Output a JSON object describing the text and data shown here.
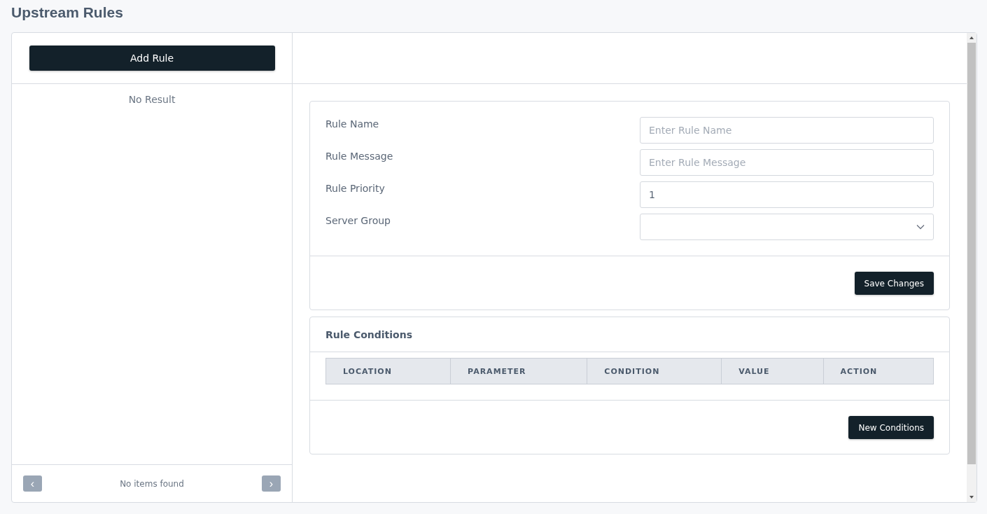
{
  "page_title": "Upstream Rules",
  "sidebar": {
    "add_button": "Add Rule",
    "empty_text": "No Result",
    "pager": {
      "prev": "‹",
      "next": "›",
      "status": "No items found"
    }
  },
  "rule_form": {
    "fields": [
      {
        "label": "Rule Name",
        "kind": "text",
        "placeholder": "Enter Rule Name"
      },
      {
        "label": "Rule Message",
        "kind": "text",
        "placeholder": "Enter Rule Message"
      },
      {
        "label": "Rule Priority",
        "kind": "number",
        "value": "1"
      },
      {
        "label": "Server Group",
        "kind": "select"
      }
    ],
    "save_button": "Save Changes"
  },
  "conditions": {
    "title": "Rule Conditions",
    "columns": [
      "LOCATION",
      "PARAMETER",
      "CONDITION",
      "VALUE",
      "ACTION"
    ],
    "new_button": "New Conditions"
  }
}
